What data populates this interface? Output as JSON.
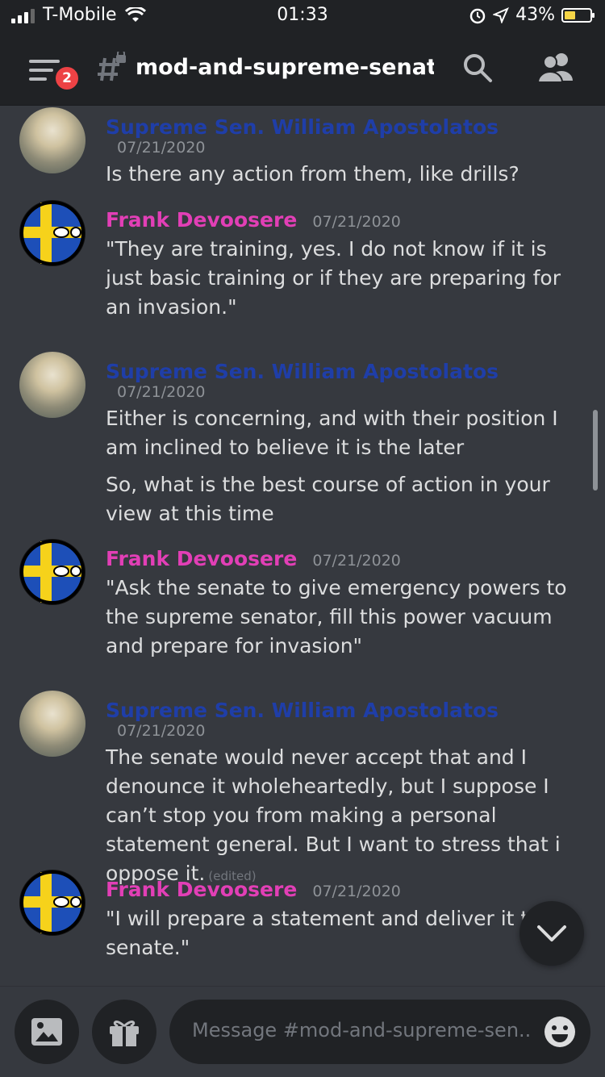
{
  "status_bar": {
    "carrier": "T-Mobile",
    "time": "01:33",
    "battery": "43%",
    "battery_level": 0.43
  },
  "header": {
    "notification_count": "2",
    "channel_name": "mod-and-supreme-senato..."
  },
  "messages": [
    {
      "author": "Supreme Sen. William Apostolatos",
      "timestamp": "07/21/2020",
      "lines": [
        "Is there any action from them, like drills?"
      ]
    },
    {
      "author": "Frank Devoosere",
      "timestamp": "07/21/2020",
      "lines": [
        "\"They are training, yes. I do not know if it is just basic training or if they are preparing for an invasion.\""
      ]
    },
    {
      "author": "Supreme Sen. William Apostolatos",
      "timestamp": "07/21/2020",
      "lines": [
        "Either is concerning, and with their position I am inclined to believe it is the later",
        "So, what is the best course of action in your view at this time"
      ]
    },
    {
      "author": "Frank Devoosere",
      "timestamp": "07/21/2020",
      "lines": [
        "\"Ask the senate to give emergency powers to the supreme senator, fill this power vacuum and prepare for invasion\""
      ]
    },
    {
      "author": "Supreme Sen. William Apostolatos",
      "timestamp": "07/21/2020",
      "lines": [
        "The senate would never accept that and I denounce it wholeheartedly, but I suppose I can’t stop you from making a personal statement general. But I want to stress that i oppose it."
      ],
      "edited": "(edited)"
    },
    {
      "author": "Frank Devoosere",
      "timestamp": "07/21/2020",
      "lines": [
        "\"I will prepare a statement and deliver it to the senate.\""
      ]
    }
  ],
  "input": {
    "placeholder": "Message #mod-and-supreme-sen..."
  },
  "colors": {
    "senator": "#1f3ea8",
    "frank": "#e23fb6",
    "background": "#36393f"
  }
}
